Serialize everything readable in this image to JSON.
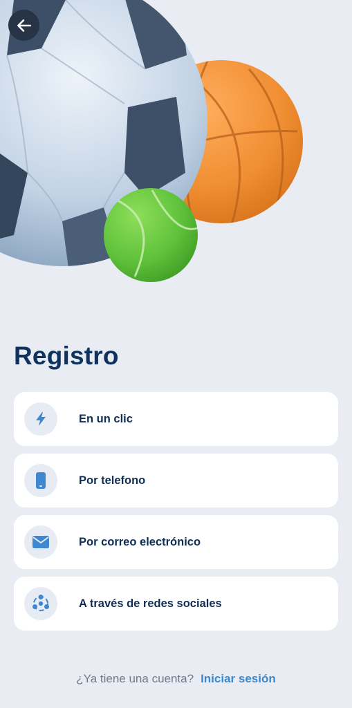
{
  "header": {
    "back_icon": "arrow-left-icon"
  },
  "hero": {
    "illustration": "sports-balls",
    "balls": [
      "soccer-ball-icon",
      "basketball-icon",
      "tennis-ball-icon"
    ]
  },
  "page": {
    "title": "Registro"
  },
  "options": [
    {
      "label": "En un clic",
      "icon": "lightning-icon"
    },
    {
      "label": "Por telefono",
      "icon": "phone-icon"
    },
    {
      "label": "Por correo electrónico",
      "icon": "envelope-icon"
    },
    {
      "label": "A través de redes sociales",
      "icon": "social-network-icon"
    }
  ],
  "footer": {
    "question": "¿Ya tiene una cuenta?",
    "login_link": "Iniciar sesión"
  },
  "colors": {
    "background": "#eaecf3",
    "title": "#0f3360",
    "icon_blue": "#3f87d0",
    "link": "#3c88c9"
  }
}
